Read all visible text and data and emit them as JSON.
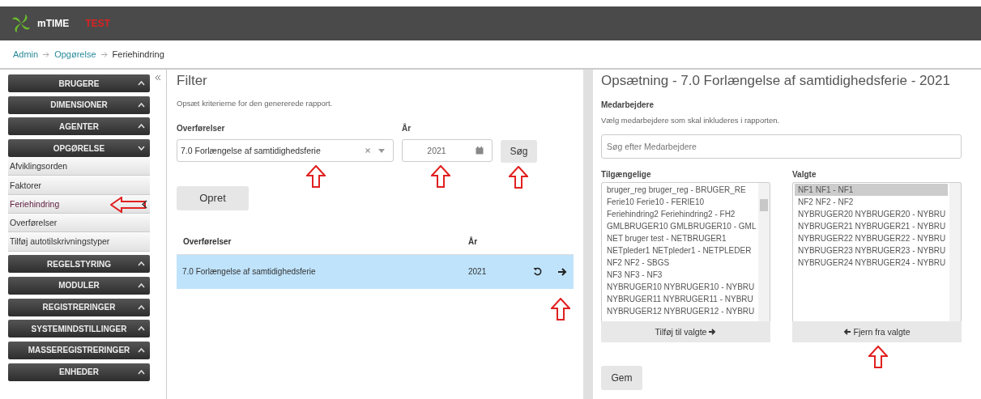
{
  "header": {
    "app_name": "mTIME",
    "environment": "TEST"
  },
  "breadcrumb": [
    {
      "label": "Admin",
      "link": true
    },
    {
      "label": "Opgørelse",
      "link": true
    },
    {
      "label": "Feriehindring",
      "link": false
    }
  ],
  "sidebar": {
    "sections": [
      {
        "label": "BRUGERE",
        "expanded": false
      },
      {
        "label": "DIMENSIONER",
        "expanded": false
      },
      {
        "label": "AGENTER",
        "expanded": false
      },
      {
        "label": "OPGØRELSE",
        "expanded": true,
        "items": [
          {
            "label": "Afviklingsorden",
            "selected": false
          },
          {
            "label": "Faktorer",
            "selected": false
          },
          {
            "label": "Feriehindring",
            "selected": true
          },
          {
            "label": "Overførelser",
            "selected": false
          },
          {
            "label": "Tilføj autotilskrivningstyper",
            "selected": false
          }
        ]
      },
      {
        "label": "REGELSTYRING",
        "expanded": false
      },
      {
        "label": "MODULER",
        "expanded": false
      },
      {
        "label": "REGISTRERINGER",
        "expanded": false
      },
      {
        "label": "SYSTEMINDSTILLINGER",
        "expanded": false
      },
      {
        "label": "MASSEREGISTRERINGER",
        "expanded": false
      },
      {
        "label": "ENHEDER",
        "expanded": false
      }
    ]
  },
  "filter": {
    "title": "Filter",
    "description": "Opsæt kriterierne for den genererede rapport.",
    "transfer_label": "Overførelser",
    "transfer_value": "7.0 Forlængelse af samtidighedsferie",
    "year_label": "År",
    "year_value": "2021",
    "search_button": "Søg",
    "create_button": "Opret",
    "table": {
      "columns": [
        "Overførelser",
        "År"
      ],
      "rows": [
        {
          "name": "7.0 Forlængelse af samtidighedsferie",
          "year": "2021",
          "selected": true
        }
      ]
    }
  },
  "setup": {
    "title": "Opsætning - 7.0 Forlængelse af samtidighedsferie - 2021",
    "section_label": "Medarbejdere",
    "description": "Vælg medarbejdere som skal inkluderes i rapporten.",
    "search_placeholder": "Søg efter Medarbejdere",
    "available_label": "Tilgængelige",
    "available": [
      {
        "label": "bruger_reg bruger_reg - BRUGER_RE",
        "selected": false
      },
      {
        "label": "Ferie10 Ferie10 - FERIE10",
        "selected": false
      },
      {
        "label": "Feriehindring2 Feriehindring2 - FH2",
        "selected": false
      },
      {
        "label": "GMLBRUGER10 GMLBRUGER10 - GML",
        "selected": false
      },
      {
        "label": "NET bruger test - NETBRUGER1",
        "selected": false
      },
      {
        "label": "NETpleder1 NETpleder1 - NETPLEDER",
        "selected": false
      },
      {
        "label": "NF2 NF2 - SBGS",
        "selected": false
      },
      {
        "label": "NF3 NF3 - NF3",
        "selected": false
      },
      {
        "label": "NYBRUGER10 NYBRUGER10 - NYBRU",
        "selected": false
      },
      {
        "label": "NYBRUGER11 NYBRUGER11 - NYBRU",
        "selected": false
      },
      {
        "label": "NYBRUGER12 NYBRUGER12 - NYBRU",
        "selected": false
      }
    ],
    "add_button": "Tilføj til valgte",
    "selected_label": "Valgte",
    "chosen": [
      {
        "label": "NF1 NF1 - NF1",
        "selected": true
      },
      {
        "label": "NF2 NF2 - NF2",
        "selected": false
      },
      {
        "label": "NYBRUGER20 NYBRUGER20 - NYBRU",
        "selected": false
      },
      {
        "label": "NYBRUGER21 NYBRUGER21 - NYBRU",
        "selected": false
      },
      {
        "label": "NYBRUGER22 NYBRUGER22 - NYBRU",
        "selected": false
      },
      {
        "label": "NYBRUGER23 NYBRUGER23 - NYBRU",
        "selected": false
      },
      {
        "label": "NYBRUGER24 NYBRUGER24 - NYBRU",
        "selected": false
      }
    ],
    "remove_button": "Fjern fra valgte",
    "save_button": "Gem"
  }
}
